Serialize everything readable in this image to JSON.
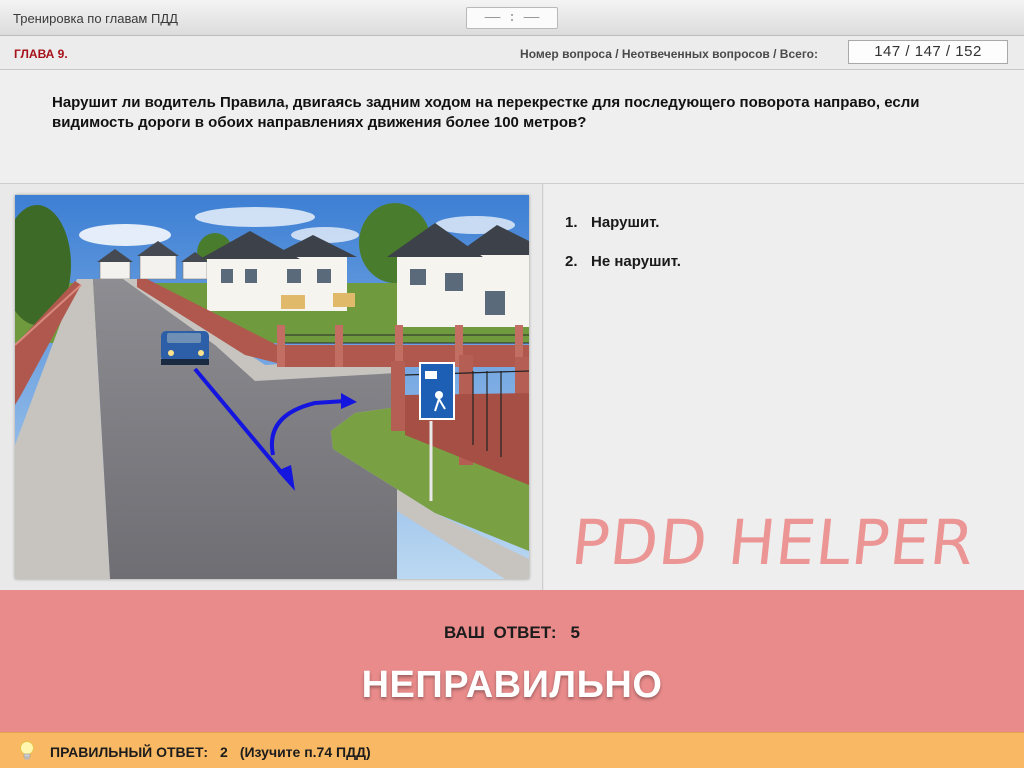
{
  "header": {
    "app_title": "Тренировка по главам ПДД",
    "timer": "—— : ——"
  },
  "chapter_bar": {
    "chapter": "ГЛАВА 9.",
    "counter_label": "Номер вопроса / Неотвеченных вопросов / Всего:",
    "counter_value": "147 / 147 / 152"
  },
  "question": {
    "text": "Нарушит ли водитель Правила, двигаясь задним ходом на перекрестке для последующего поворота направо, если видимость дороги в обоих направлениях движения более 100 метров?"
  },
  "answers": [
    {
      "num": "1.",
      "label": "Нарушит."
    },
    {
      "num": "2.",
      "label": "Не нарушит."
    }
  ],
  "watermark": "PDD HELPER",
  "result": {
    "your_answer_label": "ВАШ ОТВЕТ:",
    "your_answer_value": "5",
    "verdict": "НЕПРАВИЛЬНО"
  },
  "hint": {
    "label": "ПРАВИЛЬНЫЙ ОТВЕТ:",
    "value": "2",
    "reference": "(Изучите п.74 ПДД)"
  },
  "colors": {
    "chapter_red": "#a6121a",
    "result_band": "#e98b8b",
    "hint_band": "#f9b964",
    "watermark": "#ec8c8c",
    "arrow_blue": "#1515e0"
  },
  "icons": {
    "hint": "lightbulb-icon",
    "road_sign": "residential-zone-sign"
  }
}
